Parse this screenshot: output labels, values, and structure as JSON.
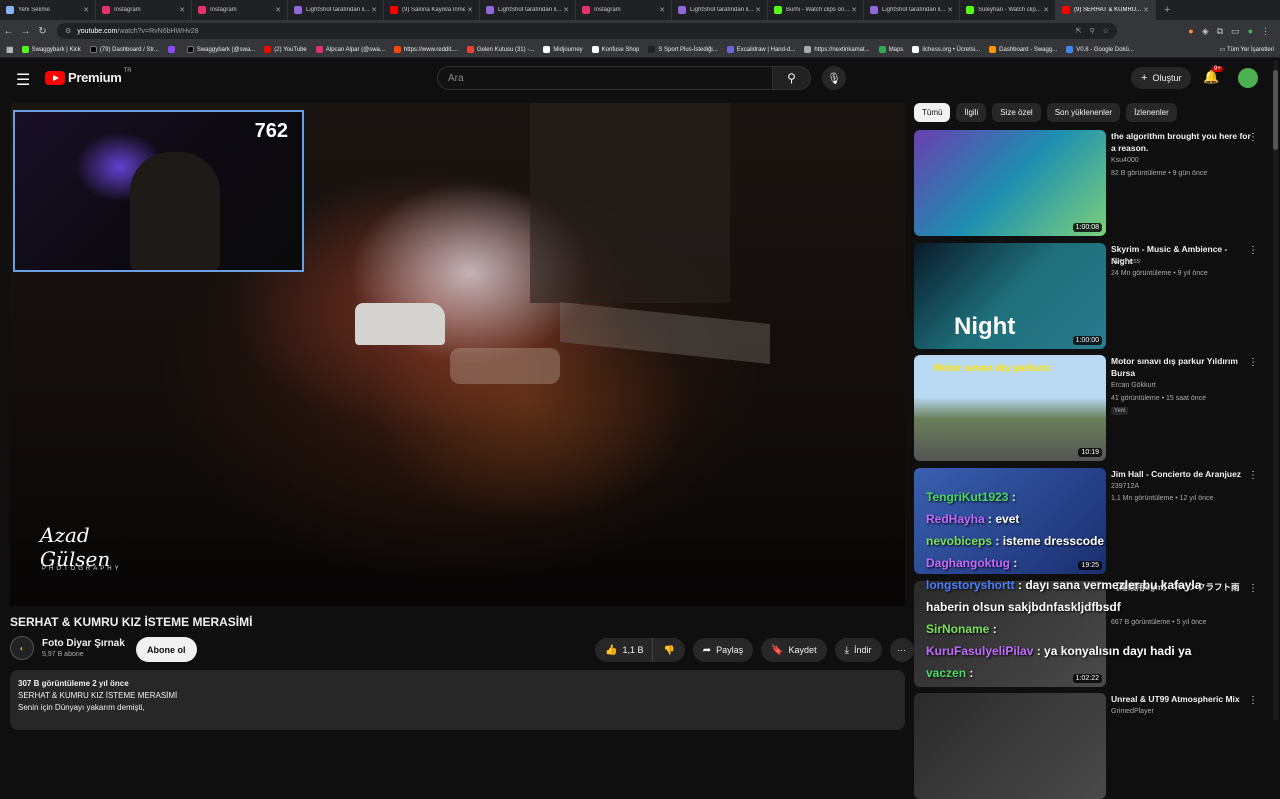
{
  "browser": {
    "tabs": [
      {
        "title": "Yeni Sekme",
        "color": "#8ab4f8"
      },
      {
        "title": "Instagram",
        "color": "#e1306c"
      },
      {
        "title": "Instagram",
        "color": "#e1306c"
      },
      {
        "title": "LightShot tarafından il...",
        "color": "#8e6ad8"
      },
      {
        "title": "(9) Salona Kayıkla İnme...",
        "color": "#ff0000"
      },
      {
        "title": "LightShot tarafından il...",
        "color": "#8e6ad8"
      },
      {
        "title": "Instagram",
        "color": "#e1306c"
      },
      {
        "title": "LightShot tarafından il...",
        "color": "#8e6ad8"
      },
      {
        "title": "Burhi - Watch clips on...",
        "color": "#53fc18"
      },
      {
        "title": "LightShot tarafından il...",
        "color": "#8e6ad8"
      },
      {
        "title": "Suleyhan - Watch clip...",
        "color": "#53fc18"
      },
      {
        "title": "(9) SERHAT & KUMRU...",
        "color": "#ff0000"
      }
    ],
    "url_host": "youtube.com",
    "url_path": "/watch?v=RvN6bHWHv28",
    "bookmarks": [
      "Swaggybark | Kick",
      "(79) Dashboard / Str...",
      "",
      "Swaggybark (@swa...",
      "(2) YouTube",
      "Alpcan Alpar (@swa...",
      "https://www.reddit....",
      "Gelen Kutusu (31) -...",
      "Midjourney",
      "Konfuse Shop",
      "S Sport Plus-İstediği...",
      "Excalidraw | Hand-d...",
      "https://nextinkamat...",
      "Maps",
      "lichess.org • Ücretsi...",
      "Dashboard - Swagg...",
      "V0.8 - Google Dokü..."
    ],
    "all_bookmarks": "Tüm Yer İşaretleri"
  },
  "header": {
    "logo": "Premium",
    "region": "TR",
    "search_placeholder": "Ara",
    "create": "Oluştur",
    "notif": "9+"
  },
  "video": {
    "overlay_count": "762",
    "watermark_name": "Azad Gülsen",
    "watermark_sub": "PHOTOGRAPHY",
    "title": "SERHAT & KUMRU KIZ İSTEME MERASİMİ",
    "channel": "Foto Diyar Şırnak",
    "subs": "5,97 B abone",
    "subscribe": "Abone ol",
    "likes": "1,1 B",
    "share": "Paylaş",
    "save": "Kaydet",
    "download": "İndir",
    "desc_meta": "307 B görüntüleme  2 yıl önce",
    "desc_line1": "SERHAT & KUMRU KIZ İSTEME MERASİMİ",
    "desc_line2": "Senin için Dünyayı yakarım demişti,"
  },
  "chips": [
    "Tümü",
    "İlgili",
    "Size özel",
    "Son yüklenenler",
    "İzlenenler"
  ],
  "recs": [
    {
      "title": "the algorithm brought you here for a reason.",
      "channel": "Ksu4000",
      "views": "82 B görüntüleme • 9 gün önce",
      "duration": "1:00:08"
    },
    {
      "title": "Skyrim - Music & Ambience - Night",
      "channel": "Everness",
      "views": "24 Mn görüntüleme • 9 yıl önce",
      "duration": "1:00:00",
      "thumb_text": "Night"
    },
    {
      "title": "Motor sınavı dış parkur Yıldırım Bursa",
      "channel": "Ercan Gökkurt",
      "views": "41 görüntüleme • 15 saat önce",
      "duration": "10:19",
      "badge": "Yeni",
      "thumb_text": "Motor sınavı dış parkuru"
    },
    {
      "title": "Jim Hall - Concierto de Aranjuez",
      "channel": "239712A",
      "views": "1,1 Mn görüntüleme • 12 yıl önce",
      "duration": "19:25"
    },
    {
      "title": "【睡眠用bgm】マインクラフト雨",
      "channel": "",
      "views": "667 B görüntüleme • 5 yıl önce",
      "duration": "1:02:22"
    },
    {
      "title": "Unreal & UT99 Atmospheric Mix",
      "channel": "GrimedPlayer",
      "views": "",
      "duration": ""
    }
  ],
  "chat": [
    {
      "user": "TengriKut1923",
      "msg": " :"
    },
    {
      "user": "RedHayha",
      "msg": " : evet"
    },
    {
      "user": "nevobiceps",
      "msg": " : isteme dresscode"
    },
    {
      "user": "Daghangoktug",
      "msg": " :"
    },
    {
      "user": "longstoryshortt",
      "msg": " : dayı sana vermezler bu kafayla"
    },
    {
      "user": "",
      "msg": "haberin olsun sakjbdnfaskljdfbsdf"
    },
    {
      "user": "SirNoname",
      "msg": " :"
    },
    {
      "user": "KuruFasulyeliPilav",
      "msg": " : ya konyalısın dayı hadi ya"
    },
    {
      "user": "vaczen",
      "msg": " :"
    }
  ]
}
